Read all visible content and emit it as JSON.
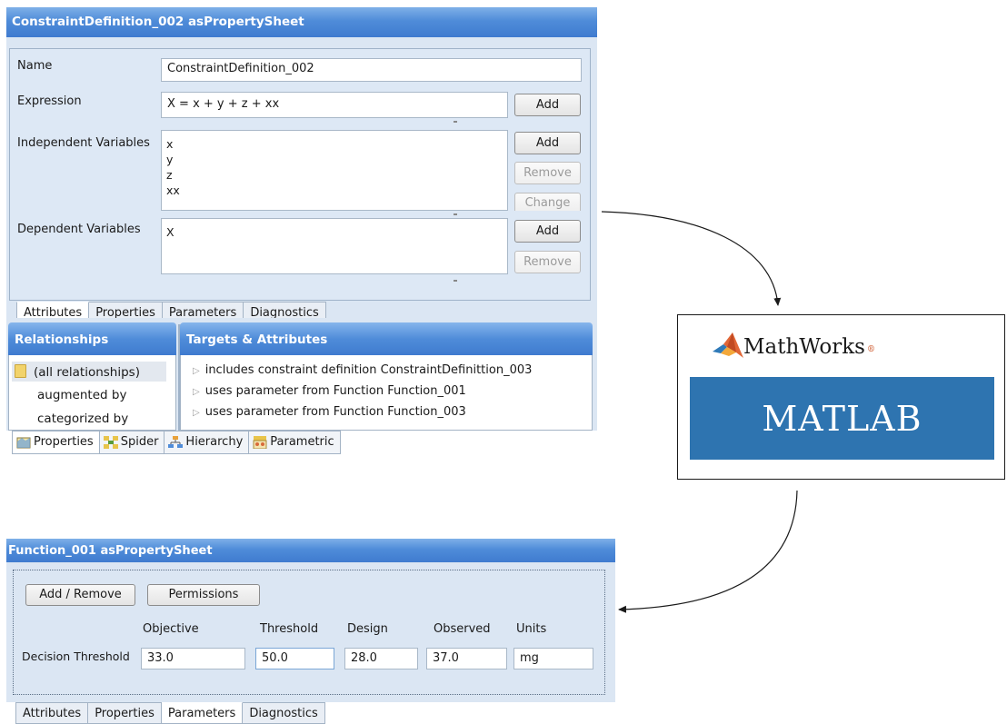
{
  "constraint_sheet": {
    "title": "ConstraintDefinition_002 asPropertySheet",
    "name_label": "Name",
    "name_value": "ConstraintDefinition_002",
    "expression_label": "Expression",
    "expression_value": "X = x + y + z + xx",
    "independent_label": "Independent Variables",
    "independent_values": [
      "x",
      "y",
      "z",
      "xx"
    ],
    "dependent_label": "Dependent Variables",
    "dependent_values": [
      "X"
    ],
    "buttons": {
      "add": "Add",
      "remove": "Remove",
      "change": "Change"
    },
    "tabs": [
      "Attributes",
      "Properties",
      "Parameters",
      "Diagnostics"
    ],
    "relationships_header": "Relationships",
    "relationships": [
      "(all relationships)",
      "augmented by",
      "categorized by"
    ],
    "targets_header": "Targets & Attributes",
    "targets": [
      "includes constraint definition ConstraintDefinittion_003",
      "uses parameter from Function  Function_001",
      "uses parameter from Function  Function_003"
    ],
    "bottom_tabs": [
      "Properties",
      "Spider",
      "Hierarchy",
      "Parametric"
    ]
  },
  "mathworks": {
    "brand": "MathWorks",
    "registered": "®",
    "product": "MATLAB",
    "band_color": "#2e74b0"
  },
  "function_sheet": {
    "title": "Function_001 asPropertySheet",
    "add_remove": "Add / Remove",
    "permissions": "Permissions",
    "columns": [
      "Objective",
      "Threshold",
      "Design",
      "Observed",
      "Units"
    ],
    "row_label": "Decision Threshold",
    "values": [
      "33.0",
      "50.0",
      "28.0",
      "37.0",
      "mg"
    ],
    "tabs": [
      "Attributes",
      "Properties",
      "Parameters",
      "Diagnostics"
    ]
  },
  "colors": {
    "title_blue": "#4f8cd9",
    "sheet_bg": "#dbe6f3",
    "matlab_orange": "#e16737"
  }
}
